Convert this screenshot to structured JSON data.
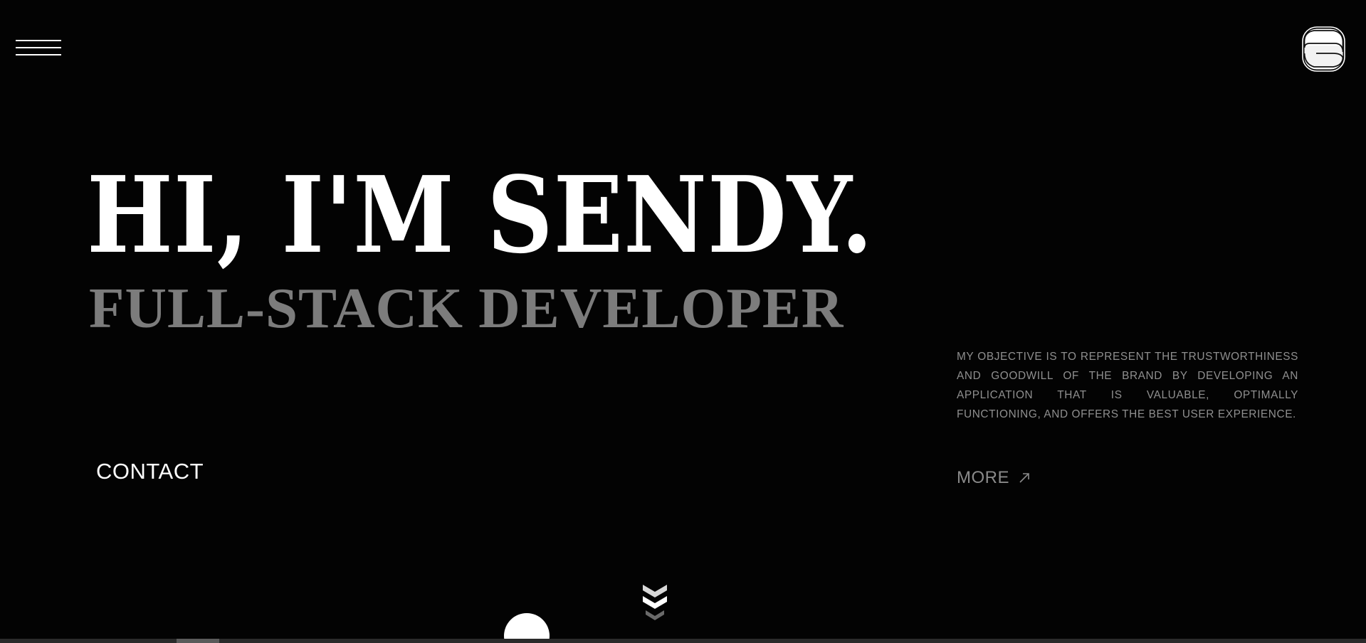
{
  "header": {
    "menu_icon": "hamburger-menu-icon",
    "theme_toggle_icon": "theme-toggle-icon"
  },
  "hero": {
    "title": "HI, I'M SENDY.",
    "subtitle": "FULL-STACK DEVELOPER"
  },
  "contact": {
    "label": "CONTACT"
  },
  "about": {
    "objective": "MY OBJECTIVE IS TO REPRESENT THE TRUSTWORTHINESS AND GOODWILL OF THE BRAND BY DEVELOPING AN APPLICATION THAT IS VALUABLE, OPTIMALLY FUNCTIONING, AND OFFERS THE BEST USER EXPERIENCE.",
    "more_label": "MORE",
    "more_icon": "arrow-up-right-icon"
  },
  "scroll": {
    "icon": "double-chevron-down-icon"
  },
  "colors": {
    "background": "#030303",
    "title": "#ffffff",
    "subtitle": "#7c7c7c",
    "body_text": "#8f8f8f"
  }
}
